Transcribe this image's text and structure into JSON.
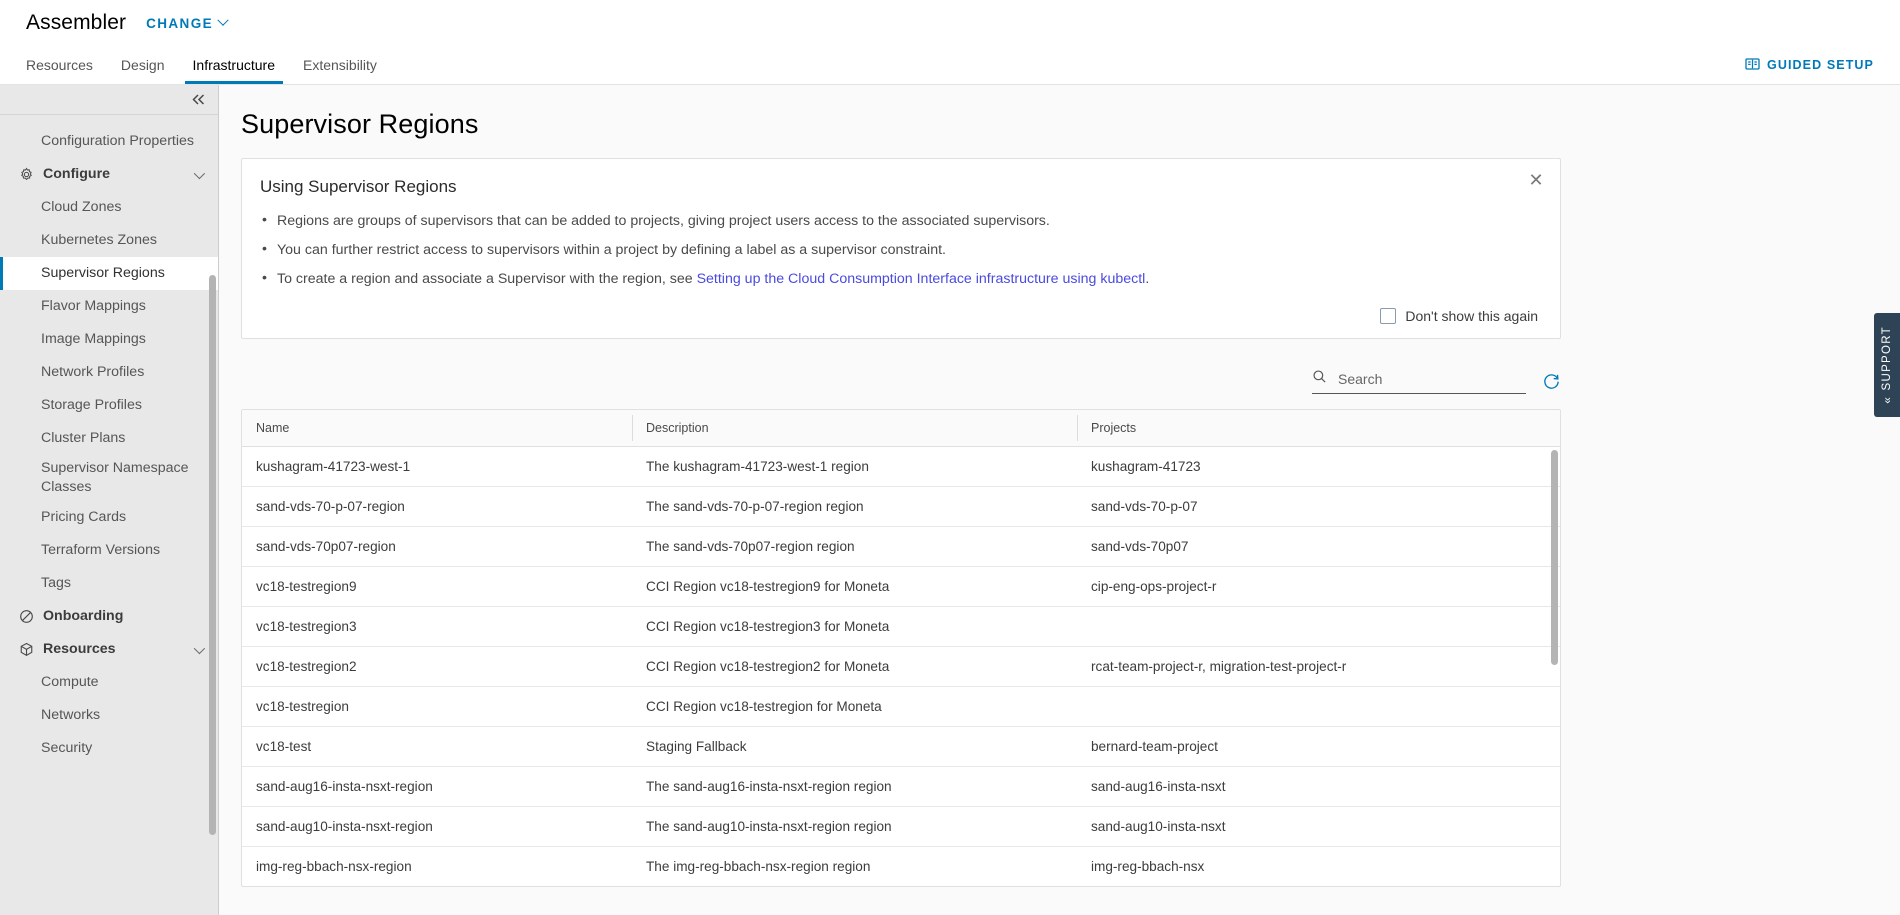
{
  "header": {
    "app_title": "Assembler",
    "change_label": "CHANGE",
    "guided_setup_label": "GUIDED SETUP",
    "tabs": [
      {
        "label": "Resources",
        "active": false
      },
      {
        "label": "Design",
        "active": false
      },
      {
        "label": "Infrastructure",
        "active": true
      },
      {
        "label": "Extensibility",
        "active": false
      }
    ]
  },
  "sidebar": {
    "items": [
      {
        "label": "Configuration Properties",
        "type": "leaf",
        "selected": false
      },
      {
        "label": "Configure",
        "type": "group",
        "icon": "gear-icon",
        "expanded": true
      },
      {
        "label": "Cloud Zones",
        "type": "leaf",
        "selected": false
      },
      {
        "label": "Kubernetes Zones",
        "type": "leaf",
        "selected": false
      },
      {
        "label": "Supervisor Regions",
        "type": "leaf",
        "selected": true
      },
      {
        "label": "Flavor Mappings",
        "type": "leaf",
        "selected": false
      },
      {
        "label": "Image Mappings",
        "type": "leaf",
        "selected": false
      },
      {
        "label": "Network Profiles",
        "type": "leaf",
        "selected": false
      },
      {
        "label": "Storage Profiles",
        "type": "leaf",
        "selected": false
      },
      {
        "label": "Cluster Plans",
        "type": "leaf",
        "selected": false
      },
      {
        "label": "Supervisor Namespace Classes",
        "type": "leaf",
        "selected": false
      },
      {
        "label": "Pricing Cards",
        "type": "leaf",
        "selected": false
      },
      {
        "label": "Terraform Versions",
        "type": "leaf",
        "selected": false
      },
      {
        "label": "Tags",
        "type": "leaf",
        "selected": false
      },
      {
        "label": "Onboarding",
        "type": "group",
        "icon": "no-entry-icon",
        "expanded": false
      },
      {
        "label": "Resources",
        "type": "group",
        "icon": "cube-icon",
        "expanded": true
      },
      {
        "label": "Compute",
        "type": "leaf",
        "selected": false
      },
      {
        "label": "Networks",
        "type": "leaf",
        "selected": false
      },
      {
        "label": "Security",
        "type": "leaf",
        "selected": false
      }
    ]
  },
  "main": {
    "page_title": "Supervisor Regions",
    "info_card": {
      "heading": "Using Supervisor Regions",
      "bullets": [
        {
          "text": "Regions are groups of supervisors that can be added to projects, giving project users access to the associated supervisors.",
          "link": null,
          "suffix": null
        },
        {
          "text": "You can further restrict access to supervisors within a project by defining a label as a supervisor constraint.",
          "link": null,
          "suffix": null
        },
        {
          "text": "To create a region and associate a Supervisor with the region, see ",
          "link": "Setting up the Cloud Consumption Interface infrastructure using kubectl",
          "suffix": "."
        }
      ],
      "dont_show_label": "Don't show this again",
      "dont_show_checked": false
    },
    "toolbar": {
      "search_placeholder": "Search",
      "search_value": "",
      "refresh_title": "Refresh"
    },
    "table": {
      "columns": [
        "Name",
        "Description",
        "Projects"
      ],
      "rows": [
        {
          "name": "kushagram-41723-west-1",
          "description": "The kushagram-41723-west-1 region",
          "projects": "kushagram-41723"
        },
        {
          "name": "sand-vds-70-p-07-region",
          "description": "The sand-vds-70-p-07-region region",
          "projects": "sand-vds-70-p-07"
        },
        {
          "name": "sand-vds-70p07-region",
          "description": "The sand-vds-70p07-region region",
          "projects": "sand-vds-70p07"
        },
        {
          "name": "vc18-testregion9",
          "description": "CCI Region vc18-testregion9 for Moneta",
          "projects": "cip-eng-ops-project-r"
        },
        {
          "name": "vc18-testregion3",
          "description": "CCI Region vc18-testregion3 for Moneta",
          "projects": ""
        },
        {
          "name": "vc18-testregion2",
          "description": "CCI Region vc18-testregion2 for Moneta",
          "projects": "rcat-team-project-r, migration-test-project-r"
        },
        {
          "name": "vc18-testregion",
          "description": "CCI Region vc18-testregion for Moneta",
          "projects": ""
        },
        {
          "name": "vc18-test",
          "description": "Staging Fallback",
          "projects": "bernard-team-project"
        },
        {
          "name": "sand-aug16-insta-nsxt-region",
          "description": "The sand-aug16-insta-nsxt-region region",
          "projects": "sand-aug16-insta-nsxt"
        },
        {
          "name": "sand-aug10-insta-nsxt-region",
          "description": "The sand-aug10-insta-nsxt-region region",
          "projects": "sand-aug10-insta-nsxt"
        },
        {
          "name": "img-reg-bbach-nsx-region",
          "description": "The img-reg-bbach-nsx-region region",
          "projects": "img-reg-bbach-nsx"
        }
      ]
    }
  },
  "support": {
    "label": "SUPPORT"
  },
  "colors": {
    "accent": "#0079b8",
    "link": "#4a4ae0",
    "sidebar_bg": "#e8e8e8",
    "support_bg": "#2e4355"
  }
}
